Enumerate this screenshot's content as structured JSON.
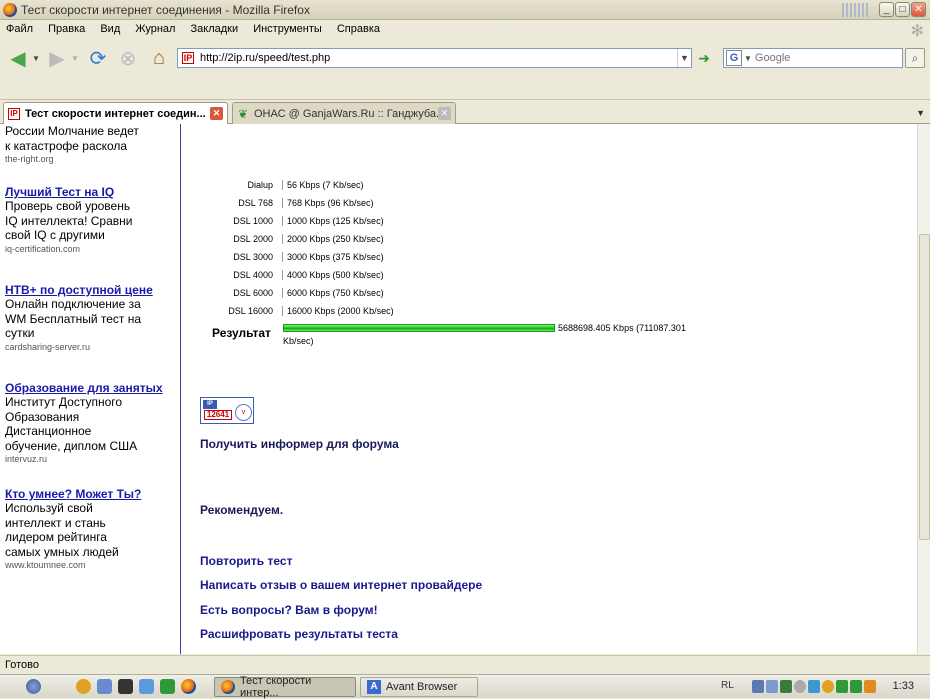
{
  "window": {
    "title": "Тест скорости интернет соединения - Mozilla Firefox"
  },
  "menu": [
    "Файл",
    "Правка",
    "Вид",
    "Журнал",
    "Закладки",
    "Инструменты",
    "Справка"
  ],
  "navbar": {
    "url": "http://2ip.ru/speed/test.php",
    "search_placeholder": "Google"
  },
  "tabs": [
    {
      "label": "Тест скорости интернет соедин...",
      "active": true
    },
    {
      "label": "ОНАС @ GanjaWars.Ru :: Ганджуба...",
      "active": false
    }
  ],
  "sidebar_ads": [
    {
      "title": "",
      "body": [
        "России Молчание ведет",
        "к катастрофе раскола"
      ],
      "url": "the-right.org"
    },
    {
      "title": "Лучший Тест на IQ",
      "body": [
        "Проверь свой уровень",
        "IQ интеллекта! Сравни",
        "свой IQ с другими"
      ],
      "url": "iq-certification.com"
    },
    {
      "title": "НТВ+ по доступной цене",
      "body": [
        "Онлайн подключение за",
        "WM Бесплатный тест на",
        "сутки"
      ],
      "url": "cardsharing-server.ru"
    },
    {
      "title": "Образование для занятых",
      "body": [
        "Институт Доступного",
        "Образования",
        "Дистанционное",
        "обучение, диплом США"
      ],
      "url": "intervuz.ru"
    },
    {
      "title": "Кто умнее? Может Ты?",
      "body": [
        "Используй свой",
        "интеллект и стань",
        "лидером рейтинга",
        "самых умных людей"
      ],
      "url": "www.ktoumnee.com"
    }
  ],
  "speed_table": [
    {
      "label": "Dialup",
      "value": "56 Kbps (7 Kb/sec)"
    },
    {
      "label": "DSL 768",
      "value": "768 Kbps (96 Kb/sec)"
    },
    {
      "label": "DSL 1000",
      "value": "1000 Kbps (125 Kb/sec)"
    },
    {
      "label": "DSL 2000",
      "value": "2000 Kbps (250 Kb/sec)"
    },
    {
      "label": "DSL 3000",
      "value": "3000 Kbps (375 Kb/sec)"
    },
    {
      "label": "DSL 4000",
      "value": "4000 Kbps (500 Kb/sec)"
    },
    {
      "label": "DSL 6000",
      "value": "6000 Kbps (750 Kb/sec)"
    },
    {
      "label": "DSL 16000",
      "value": "16000 Kbps (2000 Kb/sec)"
    }
  ],
  "result": {
    "label": "Результат",
    "value_line1": "5688698.405 Kbps (711087.301",
    "value_line2": "Kb/sec)"
  },
  "informer": {
    "logo": "IP",
    "number": "12641",
    "ring": "v"
  },
  "links": {
    "get_informer": "Получить информер для форума",
    "recommend": "Рекомендуем.",
    "repeat": "Повторить тест",
    "review": "Написать отзыв о вашем интернет провайдере",
    "forum": "Есть вопросы? Вам в форум!",
    "decode": "Расшифровать результаты теста"
  },
  "status": "Готово",
  "taskbar": {
    "buttons": [
      {
        "label": "Тест скорости интер...",
        "active": true
      },
      {
        "label": "Avant Browser",
        "active": false
      }
    ],
    "lang": "RL",
    "clock": "1:33"
  }
}
